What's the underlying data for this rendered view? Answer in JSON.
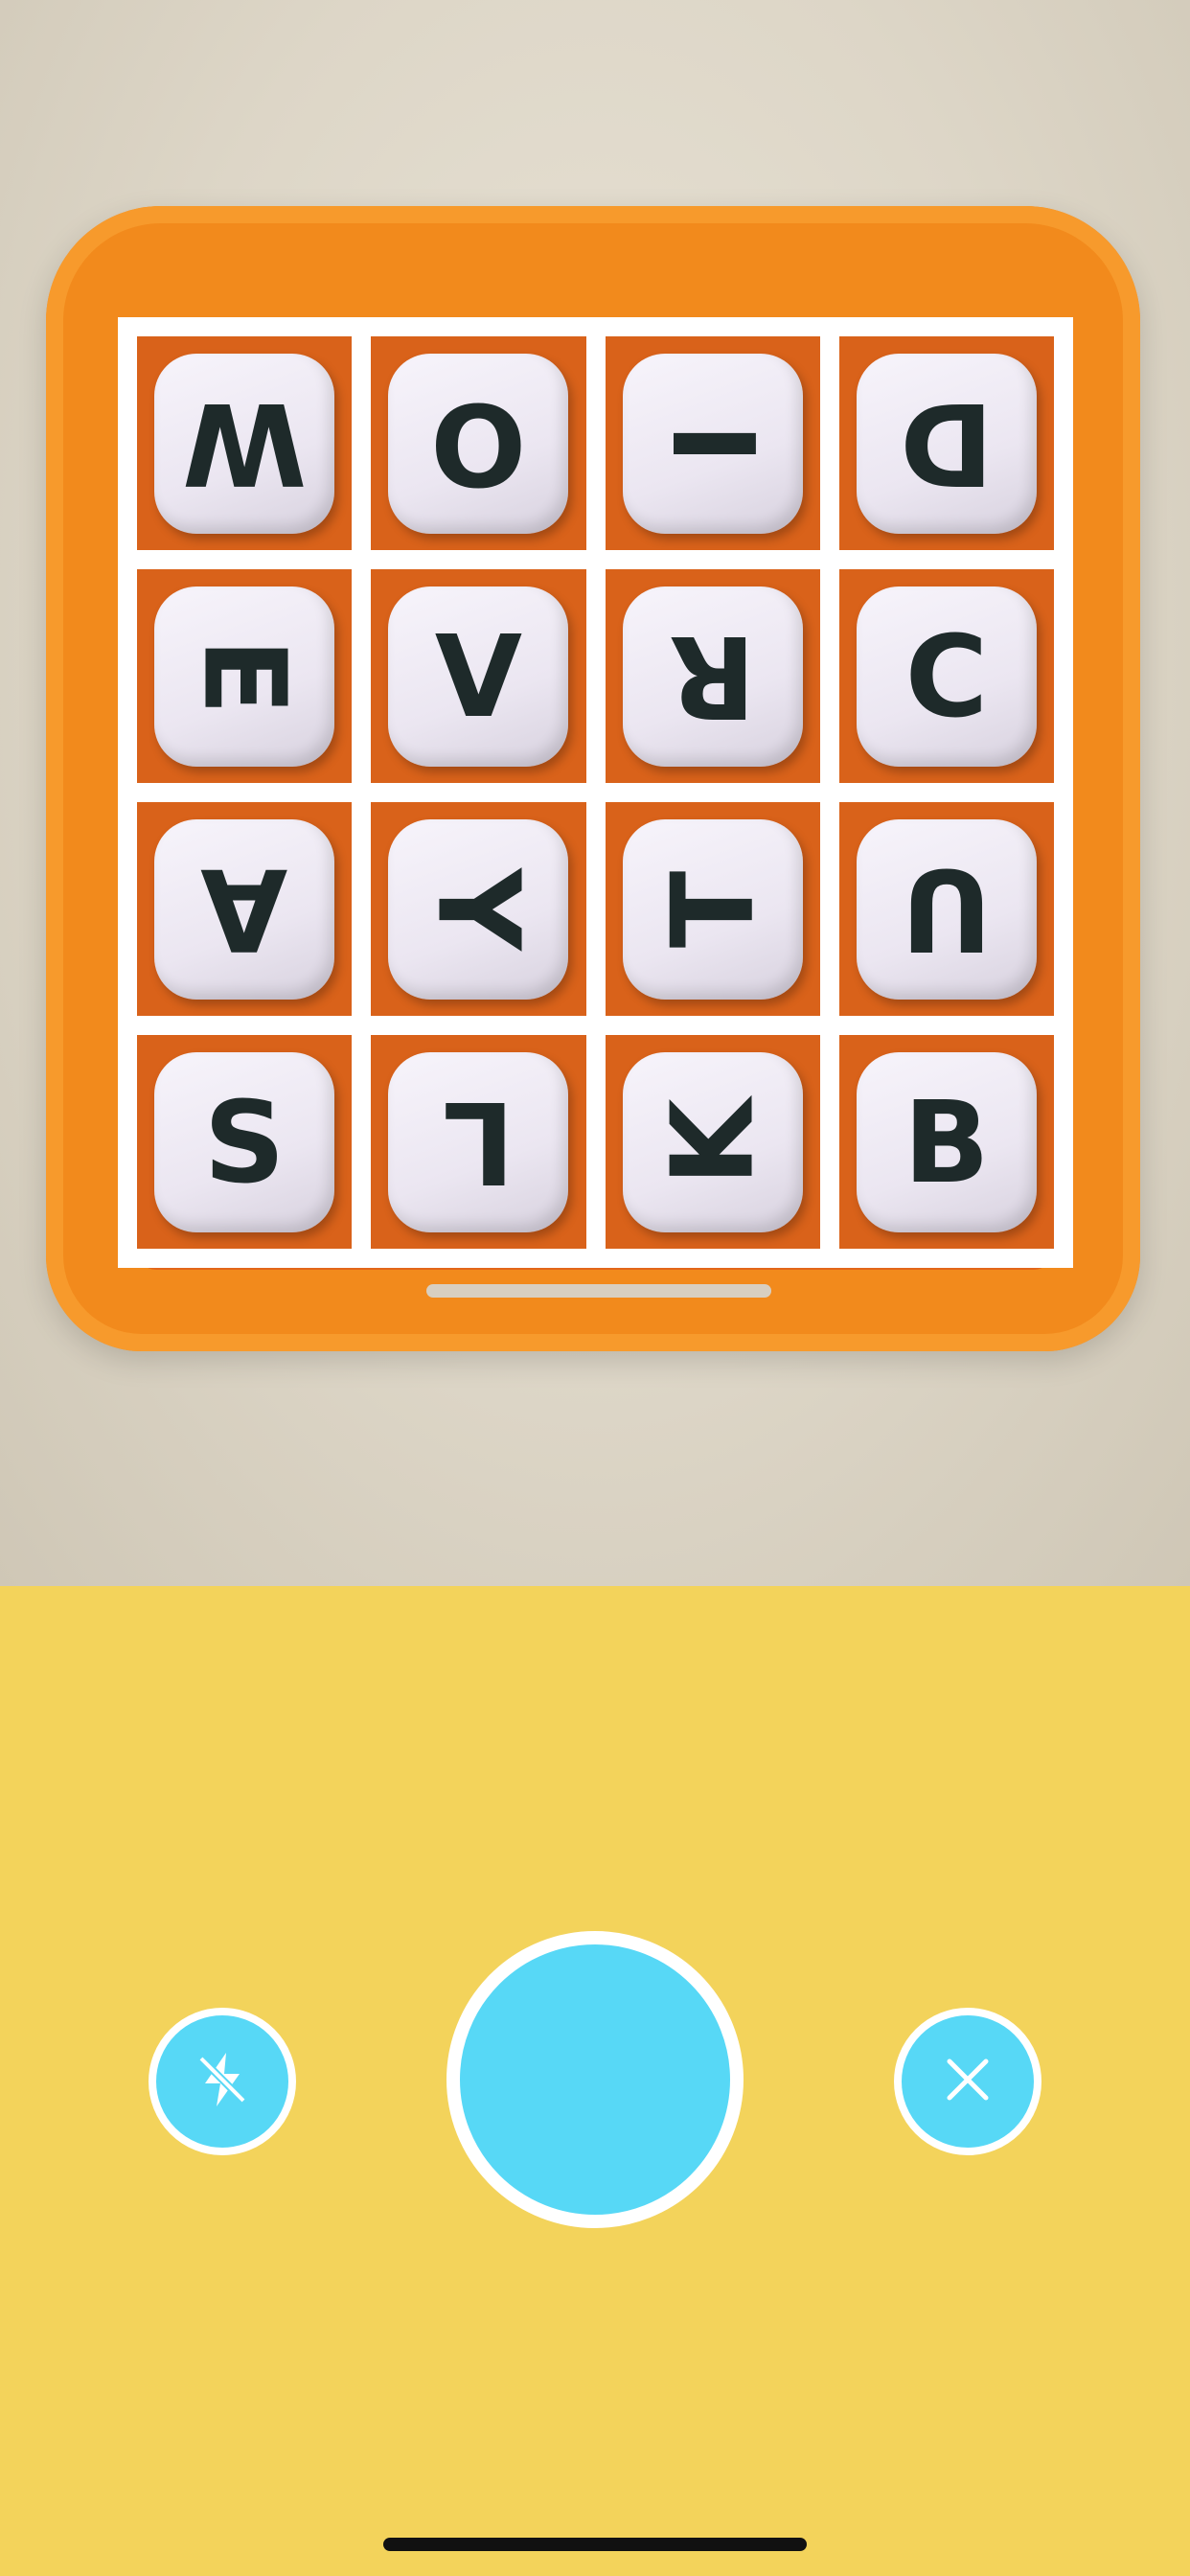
{
  "board": {
    "rows": [
      [
        {
          "letter": "W",
          "orientation": "rot180"
        },
        {
          "letter": "O",
          "orientation": "rot180"
        },
        {
          "letter": "I",
          "orientation": "rot90"
        },
        {
          "letter": "D",
          "orientation": "rot180"
        }
      ],
      [
        {
          "letter": "E",
          "orientation": "rot90"
        },
        {
          "letter": "V",
          "orientation": "upright"
        },
        {
          "letter": "R",
          "orientation": "rot180"
        },
        {
          "letter": "C",
          "orientation": "upright"
        }
      ],
      [
        {
          "letter": "A",
          "orientation": "rot180"
        },
        {
          "letter": "Y",
          "orientation": "rot90"
        },
        {
          "letter": "T",
          "orientation": "rot270"
        },
        {
          "letter": "U",
          "orientation": "rot180"
        }
      ],
      [
        {
          "letter": "S",
          "orientation": "upright"
        },
        {
          "letter": "L",
          "orientation": "rot180"
        },
        {
          "letter": "K",
          "orientation": "rot270"
        },
        {
          "letter": "B",
          "orientation": "upright"
        }
      ]
    ]
  },
  "controls": {
    "flash_icon": "flash-off-icon",
    "shutter_icon": "shutter-icon",
    "close_icon": "close-icon"
  },
  "colors": {
    "background": "#f3d35b",
    "button_fill": "#57d8f6",
    "button_border": "#ffffff",
    "grid_lines": "#ffffff"
  }
}
